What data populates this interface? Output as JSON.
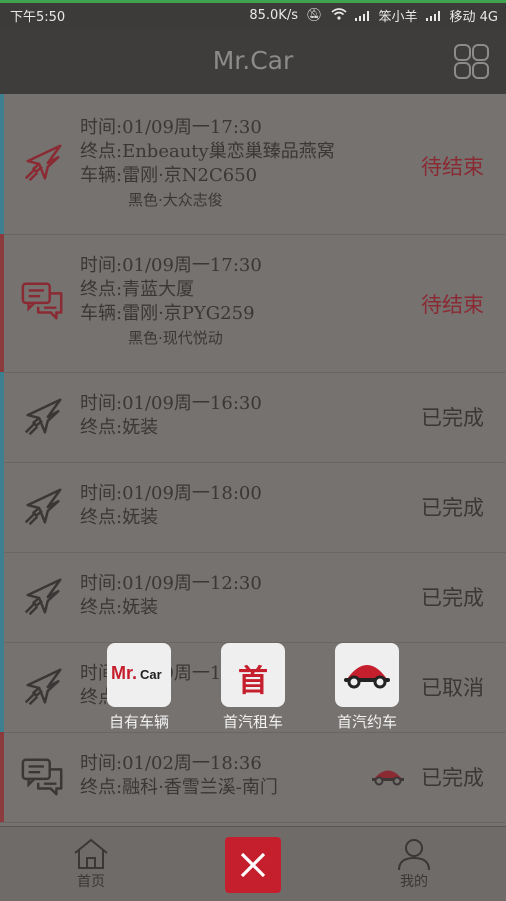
{
  "status_bar": {
    "time": "下午5:50",
    "net_speed": "85.0K/s",
    "carrier1": "笨小羊",
    "carrier2": "移动 4G"
  },
  "header": {
    "title": "Mr.Car",
    "menu_icon": "grid-icon"
  },
  "colors": {
    "accent_red": "#c51f2e",
    "pending": "#8a2a33",
    "done": "#3a3736",
    "bar_blue": "#3d7f8f",
    "bar_red": "#8b3a3e"
  },
  "orders": [
    {
      "icon": "plane-icon",
      "time": "时间:01/09周一17:30",
      "dest": "终点:Enbeauty巢恋巢臻品燕窝",
      "vehicle": "车辆:雷刚·京N2C650",
      "vehicle_sub": "黑色·大众志俊",
      "status": "待结束",
      "status_type": "pending",
      "bar": "blue"
    },
    {
      "icon": "chat-icon",
      "time": "时间:01/09周一17:30",
      "dest": "终点:青蓝大厦",
      "vehicle": "车辆:雷刚·京PYG259",
      "vehicle_sub": "黑色·现代悦动",
      "status": "待结束",
      "status_type": "pending",
      "bar": "red"
    },
    {
      "icon": "plane-icon",
      "time": "时间:01/09周一16:30",
      "dest": "终点:妩装",
      "status": "已完成",
      "status_type": "done",
      "bar": "blue"
    },
    {
      "icon": "plane-icon",
      "time": "时间:01/09周一18:00",
      "dest": "终点:妩装",
      "status": "已完成",
      "status_type": "done",
      "bar": "blue"
    },
    {
      "icon": "plane-icon",
      "time": "时间:01/09周一12:30",
      "dest": "终点:妩装",
      "status": "已完成",
      "status_type": "done",
      "bar": "blue"
    },
    {
      "icon": "plane-icon",
      "time": "时间:01/09周一1",
      "dest": "终点:",
      "status": "已取消",
      "status_type": "done",
      "bar": "blue"
    },
    {
      "icon": "chat-icon",
      "time": "时间:01/02周一18:36",
      "dest": "终点:融科·香雪兰溪-南门",
      "status": "已完成",
      "status_type": "done",
      "bar": "red",
      "badge": "car-badge-icon"
    }
  ],
  "app_menu": [
    {
      "label": "自有车辆",
      "logo_text": "Mr.",
      "logo_text2": "Car",
      "icon": "mrcar-logo-icon"
    },
    {
      "label": "首汽租车",
      "logo_text": "首",
      "icon": "shouqi-logo-icon"
    },
    {
      "label": "首汽约车",
      "icon": "car-logo-icon"
    }
  ],
  "bottom_nav": {
    "home": "首页",
    "mine": "我的",
    "close_icon": "close-icon"
  }
}
